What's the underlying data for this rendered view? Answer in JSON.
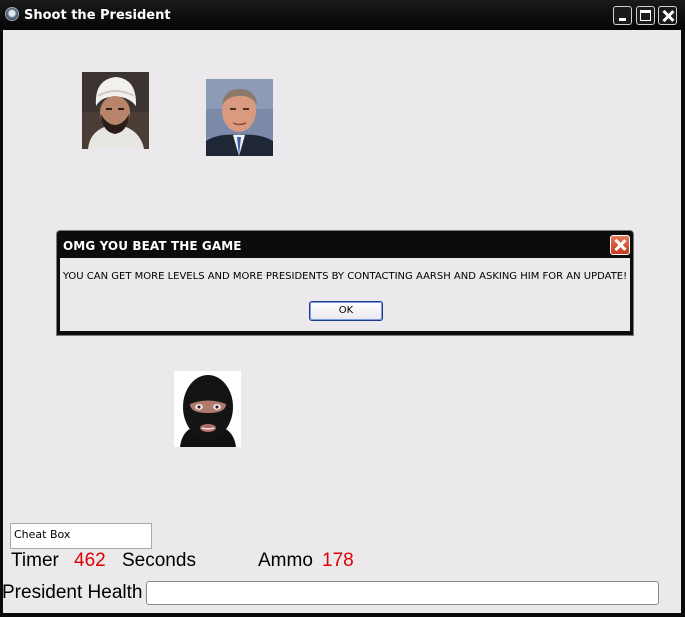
{
  "window": {
    "title": "Shoot the President"
  },
  "dialog": {
    "title": "OMG YOU BEAT THE GAME",
    "message": "YOU CAN GET MORE LEVELS AND MORE PRESIDENTS BY CONTACTING AARSH AND ASKING HIM FOR AN UPDATE!",
    "ok_label": "OK"
  },
  "targets": [
    {
      "icon": "turban-man-portrait-icon"
    },
    {
      "icon": "president-portrait-icon"
    },
    {
      "icon": "masked-man-portrait-icon"
    }
  ],
  "cheat_box": {
    "value": "Cheat Box"
  },
  "hud": {
    "timer_label": "Timer",
    "timer_value": "462",
    "seconds_label": "Seconds",
    "ammo_label": "Ammo",
    "ammo_value": "178",
    "health_label": "President Health",
    "health_fraction": 0
  },
  "colors": {
    "accent_value": "#e00000",
    "client_bg": "#ece9ec",
    "titlebar": "#0a0a0a",
    "dialog_close": "#d2482a"
  }
}
